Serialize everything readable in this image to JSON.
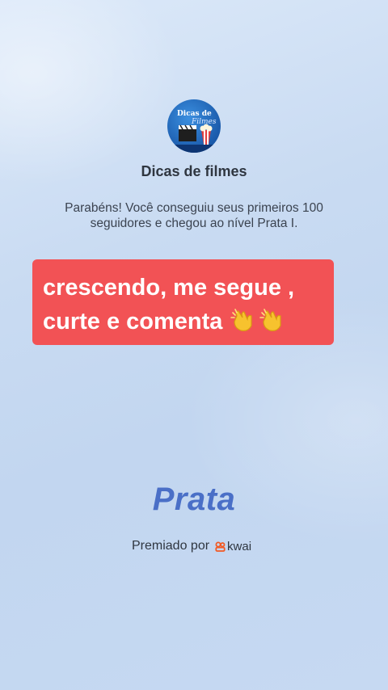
{
  "channel": {
    "avatar_icon": "movie-clapperboard-popcorn-avatar",
    "avatar_text": "Dicas de Filmes",
    "name": "Dicas de filmes"
  },
  "achievement": {
    "message": "Parabéns! Você conseguiu seus primeiros 100 seguidores e chegou ao nível Prata I.",
    "tier": "Prata",
    "awarded_by_label": "Premiado por",
    "brand_icon": "kwai-logo-icon",
    "brand_name": "kwai"
  },
  "overlay": {
    "line1": "crescendo, me segue ,",
    "line2": "curte e comenta",
    "emoji_icon": "clapping-hands-icon",
    "emoji_count": 2
  },
  "colors": {
    "overlay_bg": "#f25255",
    "tier_text": "#4a6fc7",
    "brand_orange": "#f25a24"
  }
}
